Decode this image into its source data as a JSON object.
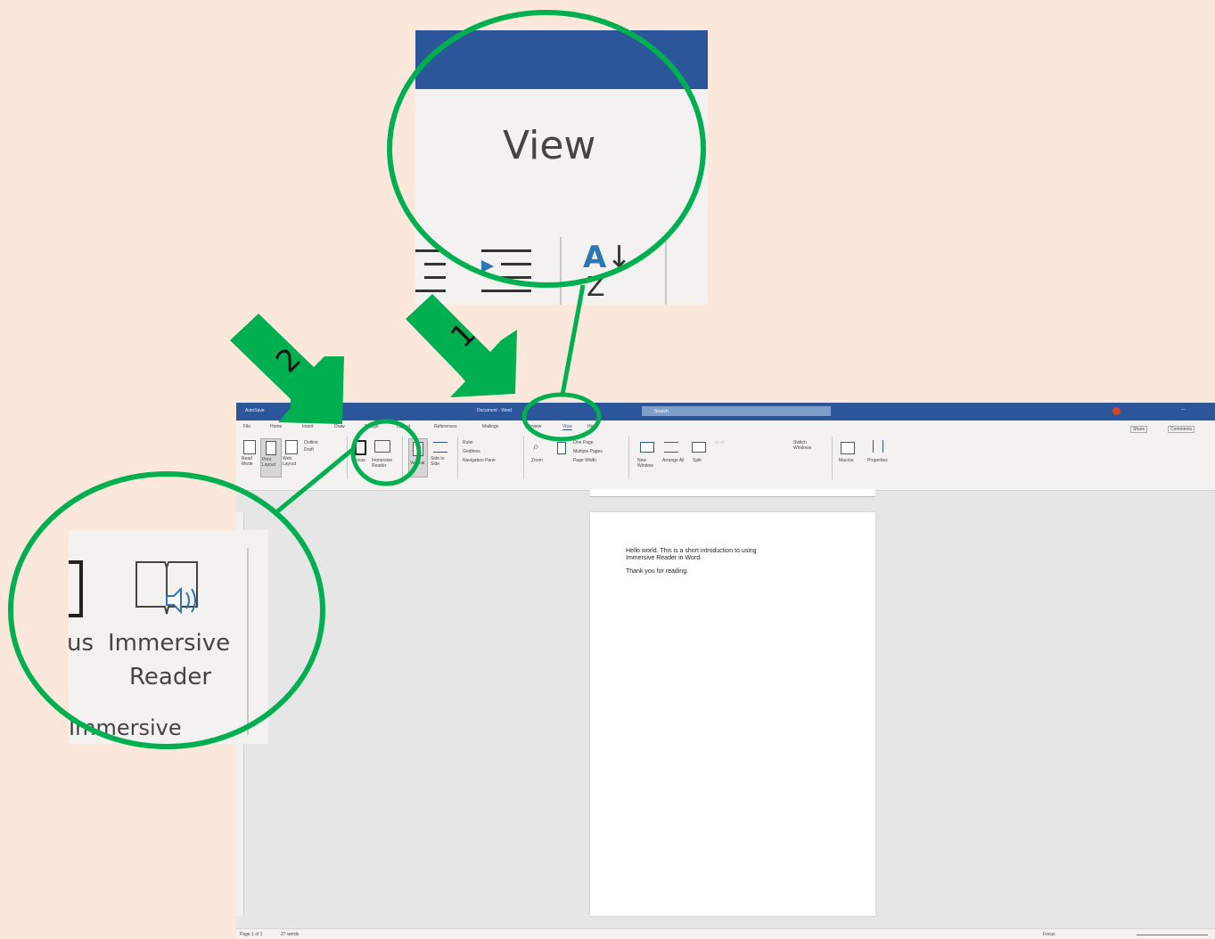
{
  "zoom_inset_view": {
    "tab_label": "View"
  },
  "zoom_inset_immersive": {
    "focus_partial": "us",
    "button_line1": "Immersive",
    "button_line2": "Reader",
    "group_label": "Immersive"
  },
  "step_labels": {
    "step1": "1",
    "step2": "2"
  },
  "word": {
    "document_text_line1": "Hello world. This is a short introduction to using",
    "document_text_line2": "Immersive Reader in Word.",
    "document_text_line3": "Thank you for reading.",
    "title": "Document - Word",
    "search_placeholder": "Search",
    "tabs": [
      "File",
      "Home",
      "Insert",
      "Draw",
      "Design",
      "Layout",
      "References",
      "Mailings",
      "Review",
      "View",
      "Help"
    ],
    "ribbon": {
      "read_mode": "Read Mode",
      "print_layout": "Print Layout",
      "web_layout": "Web Layout",
      "outline": "Outline",
      "draft": "Draft",
      "focus": "Focus",
      "immersive_reader": "Immersive Reader",
      "vertical": "Vertical",
      "side_to_side": "Side to Side",
      "ruler": "Ruler",
      "gridlines": "Gridlines",
      "navigation_pane": "Navigation Pane",
      "zoom": "Zoom",
      "one_page": "One Page",
      "multiple_pages": "Multiple Pages",
      "page_width": "Page Width",
      "new_window": "New Window",
      "arrange_all": "Arrange All",
      "split": "Split",
      "switch_windows": "Switch Windows",
      "macros": "Macros",
      "properties": "Properties",
      "share": "Share",
      "comments": "Comments"
    },
    "status": {
      "page": "Page 1 of 1",
      "words": "27 words",
      "zoom": "Focus"
    }
  },
  "colors": {
    "accent_green": "#00b050",
    "word_blue": "#2b579a",
    "background": "#fbe8da"
  }
}
